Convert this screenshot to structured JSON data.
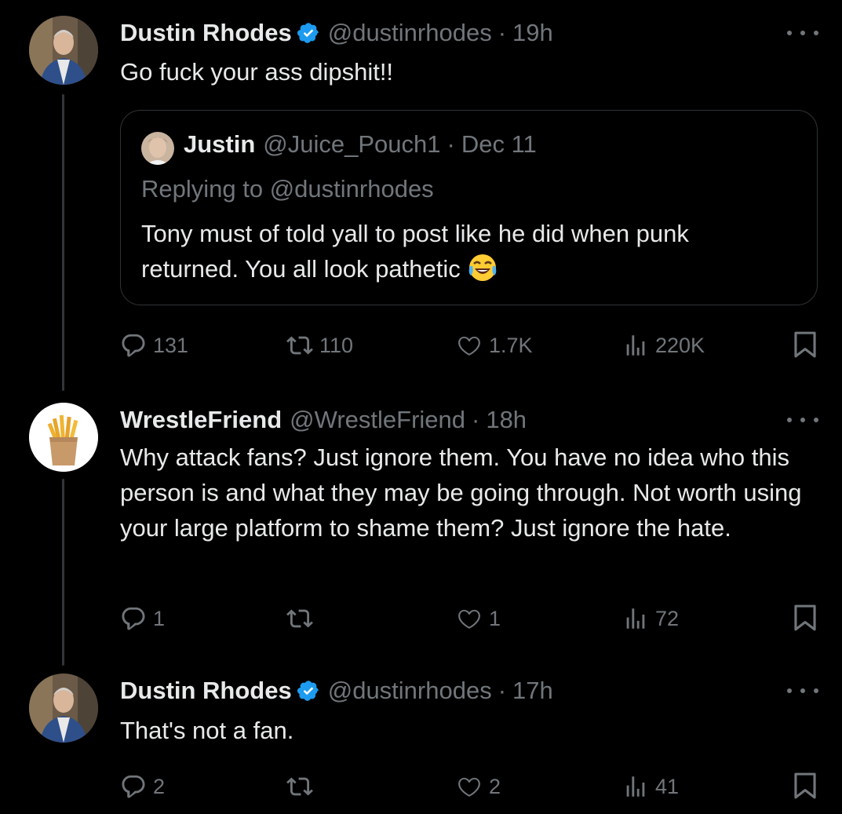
{
  "tweets": [
    {
      "author": "Dustin Rhodes",
      "verified": true,
      "handle": "@dustinrhodes",
      "separator": "·",
      "time": "19h",
      "text": "Go fuck your ass dipshit!!",
      "quote": {
        "author": "Justin",
        "handle": "@Juice_Pouch1",
        "separator": "·",
        "date": "Dec 11",
        "replying_to": "Replying to @dustinrhodes",
        "text": "Tony must of told yall to post like he did when punk returned. You all look pathetic",
        "emoji": "face-with-tears-of-joy"
      },
      "stats": {
        "replies": "131",
        "reposts": "110",
        "likes": "1.7K",
        "views": "220K"
      }
    },
    {
      "author": "WrestleFriend",
      "verified": false,
      "handle": "@WrestleFriend",
      "separator": "·",
      "time": "18h",
      "text": "Why attack fans? Just ignore them. You have no idea who this person is and what they may be going through. Not worth using your large platform to shame them? Just ignore the hate.",
      "stats": {
        "replies": "1",
        "reposts": "",
        "likes": "1",
        "views": "72"
      }
    },
    {
      "author": "Dustin Rhodes",
      "verified": true,
      "handle": "@dustinrhodes",
      "separator": "·",
      "time": "17h",
      "text": "That's not a fan.",
      "stats": {
        "replies": "2",
        "reposts": "",
        "likes": "2",
        "views": "41"
      }
    }
  ],
  "colors": {
    "background": "#000000",
    "text_primary": "#e7e9ea",
    "text_secondary": "#71767b",
    "verified_blue": "#1d9bf0",
    "border": "#2f3336"
  },
  "icons": [
    "reply-icon",
    "repost-icon",
    "like-icon",
    "views-icon",
    "bookmark-icon",
    "more-icon",
    "verified-badge-icon"
  ]
}
